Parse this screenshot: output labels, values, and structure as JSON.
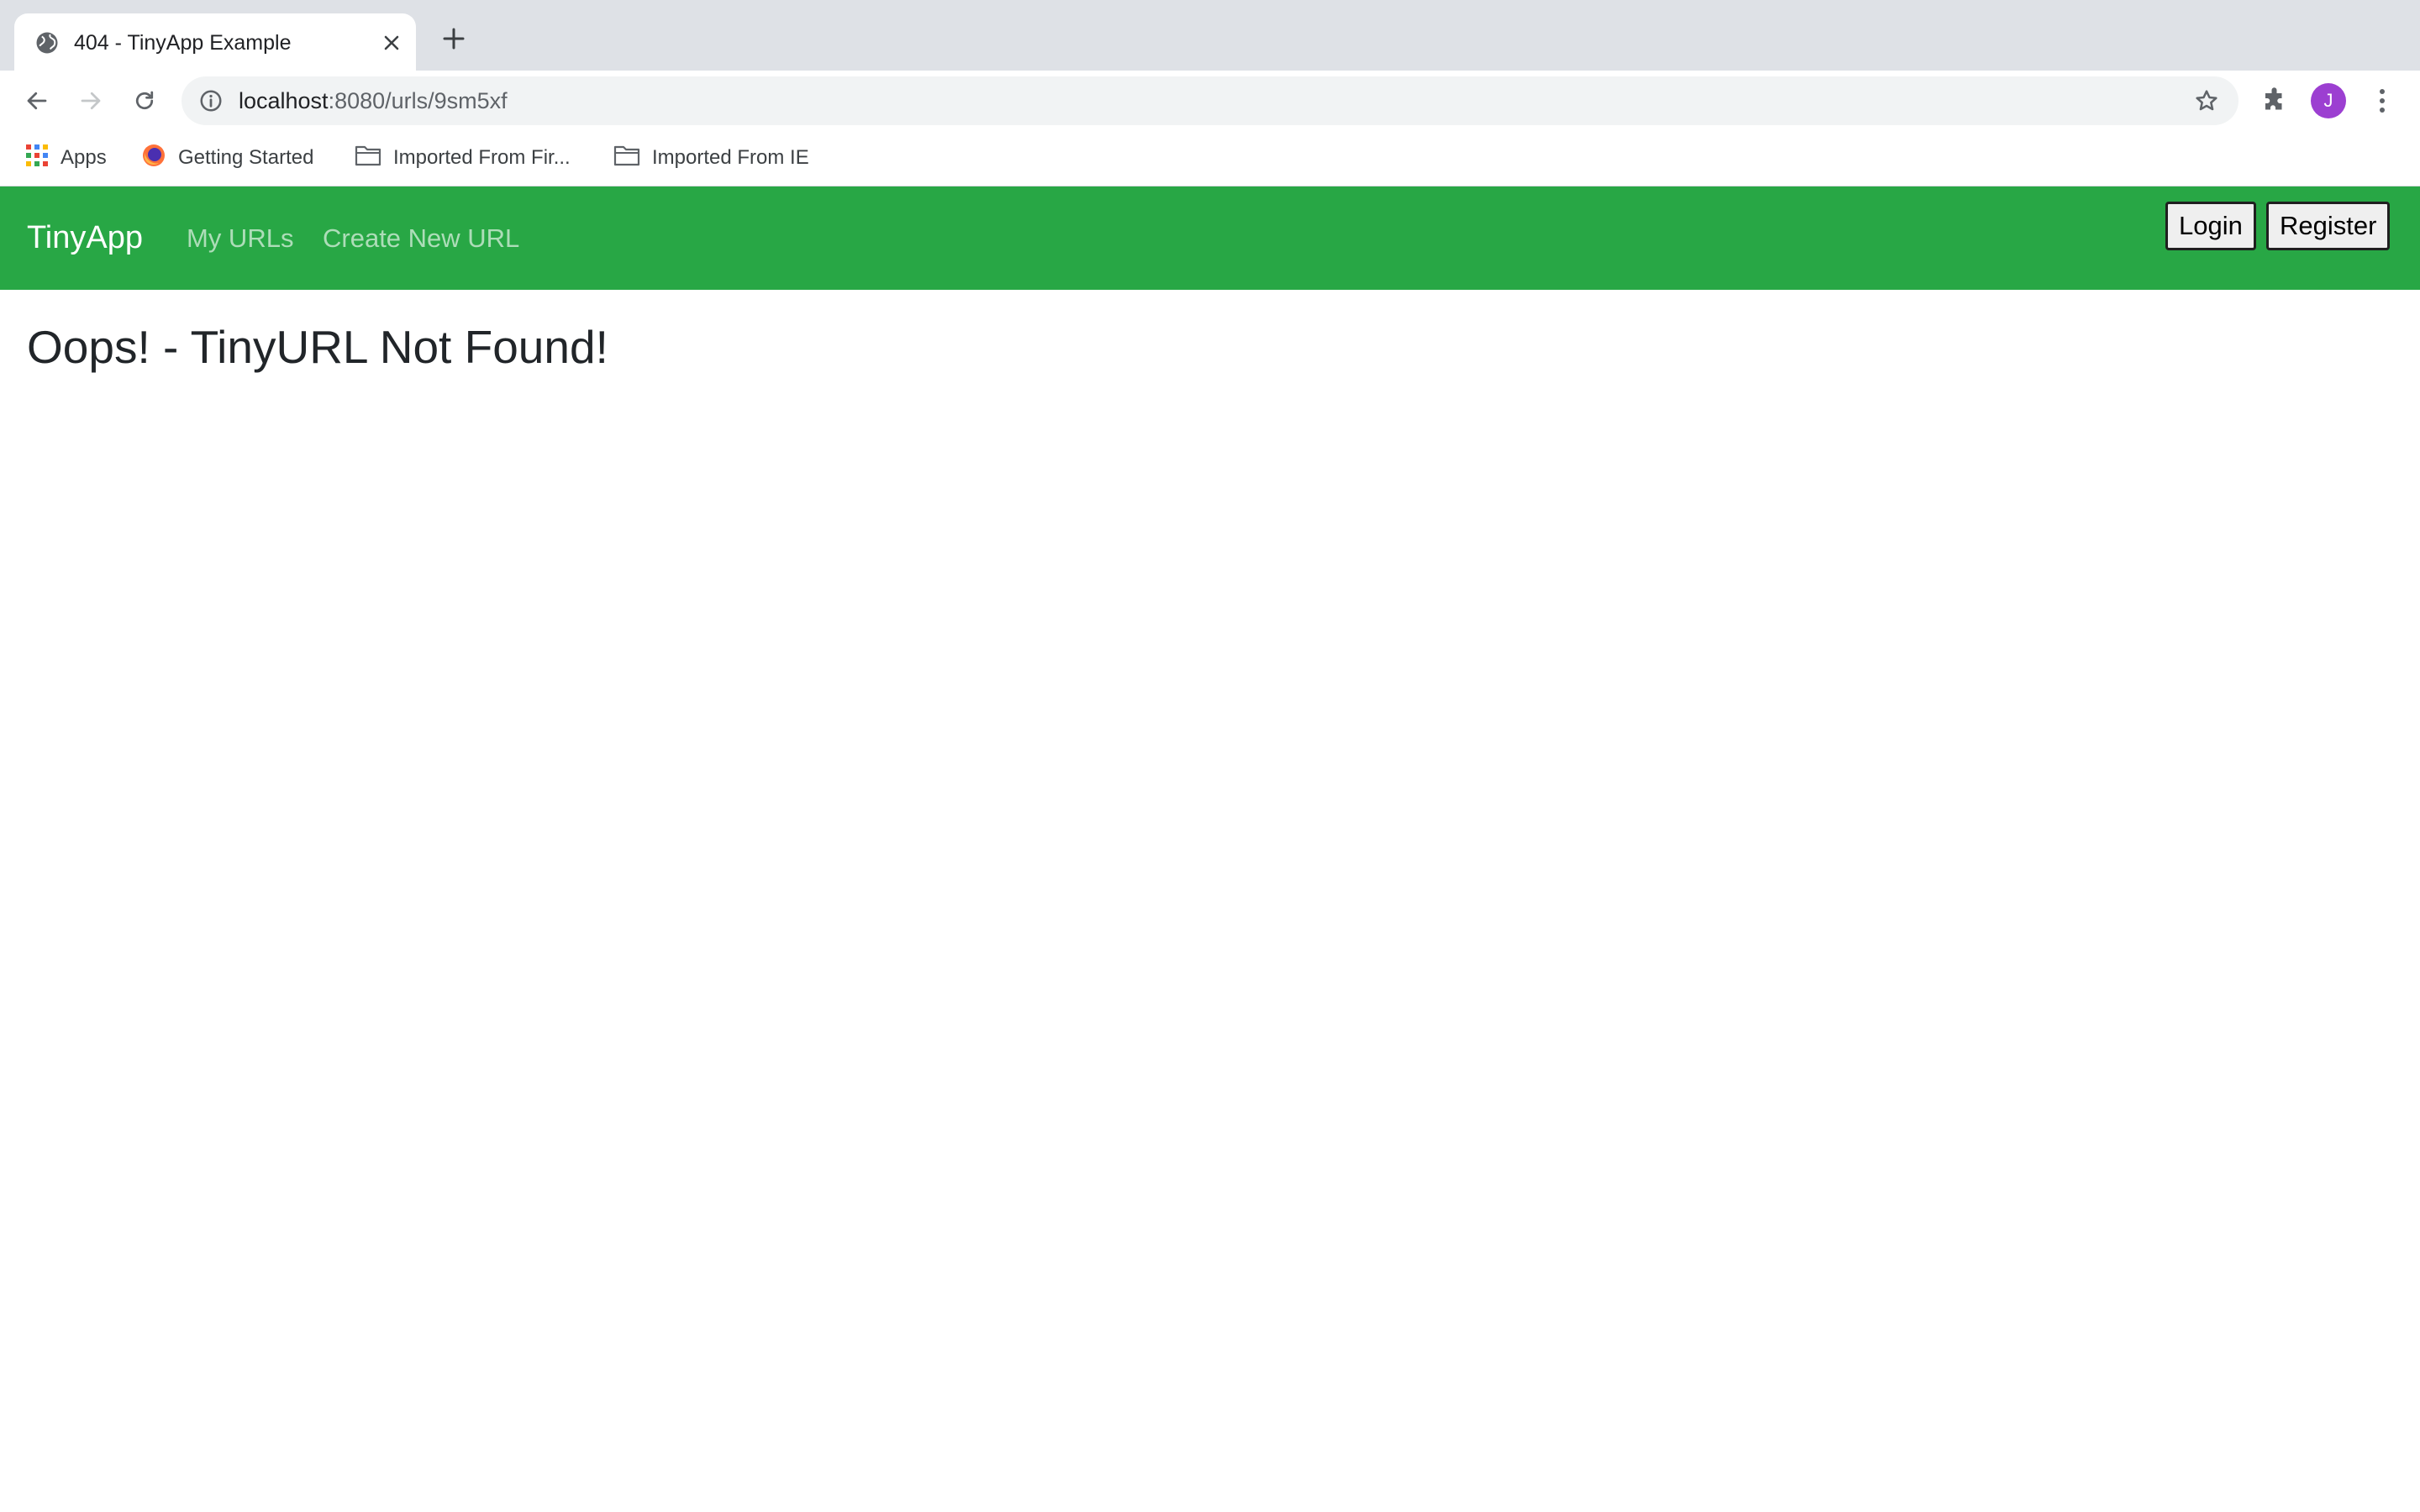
{
  "browser": {
    "tab": {
      "title": "404 - TinyApp Example",
      "icon": "globe-icon"
    },
    "toolbar": {
      "url_host": "localhost",
      "url_path": ":8080/urls/9sm5xf",
      "profile_initial": "J"
    },
    "bookmarks": [
      {
        "label": "Apps",
        "icon": "apps-grid-icon"
      },
      {
        "label": "Getting Started",
        "icon": "firefox-icon"
      },
      {
        "label": "Imported From Fir...",
        "icon": "folder-icon"
      },
      {
        "label": "Imported From IE",
        "icon": "folder-icon"
      }
    ]
  },
  "app": {
    "brand": "TinyApp",
    "nav": {
      "my_urls": "My URLs",
      "create_new_url": "Create New URL"
    },
    "buttons": {
      "login": "Login",
      "register": "Register"
    },
    "heading": "Oops! - TinyURL Not Found!",
    "colors": {
      "navbar": "#28a745",
      "nav_link": "rgba(255,255,255,0.62)",
      "avatar": "#9c3fd1"
    }
  }
}
